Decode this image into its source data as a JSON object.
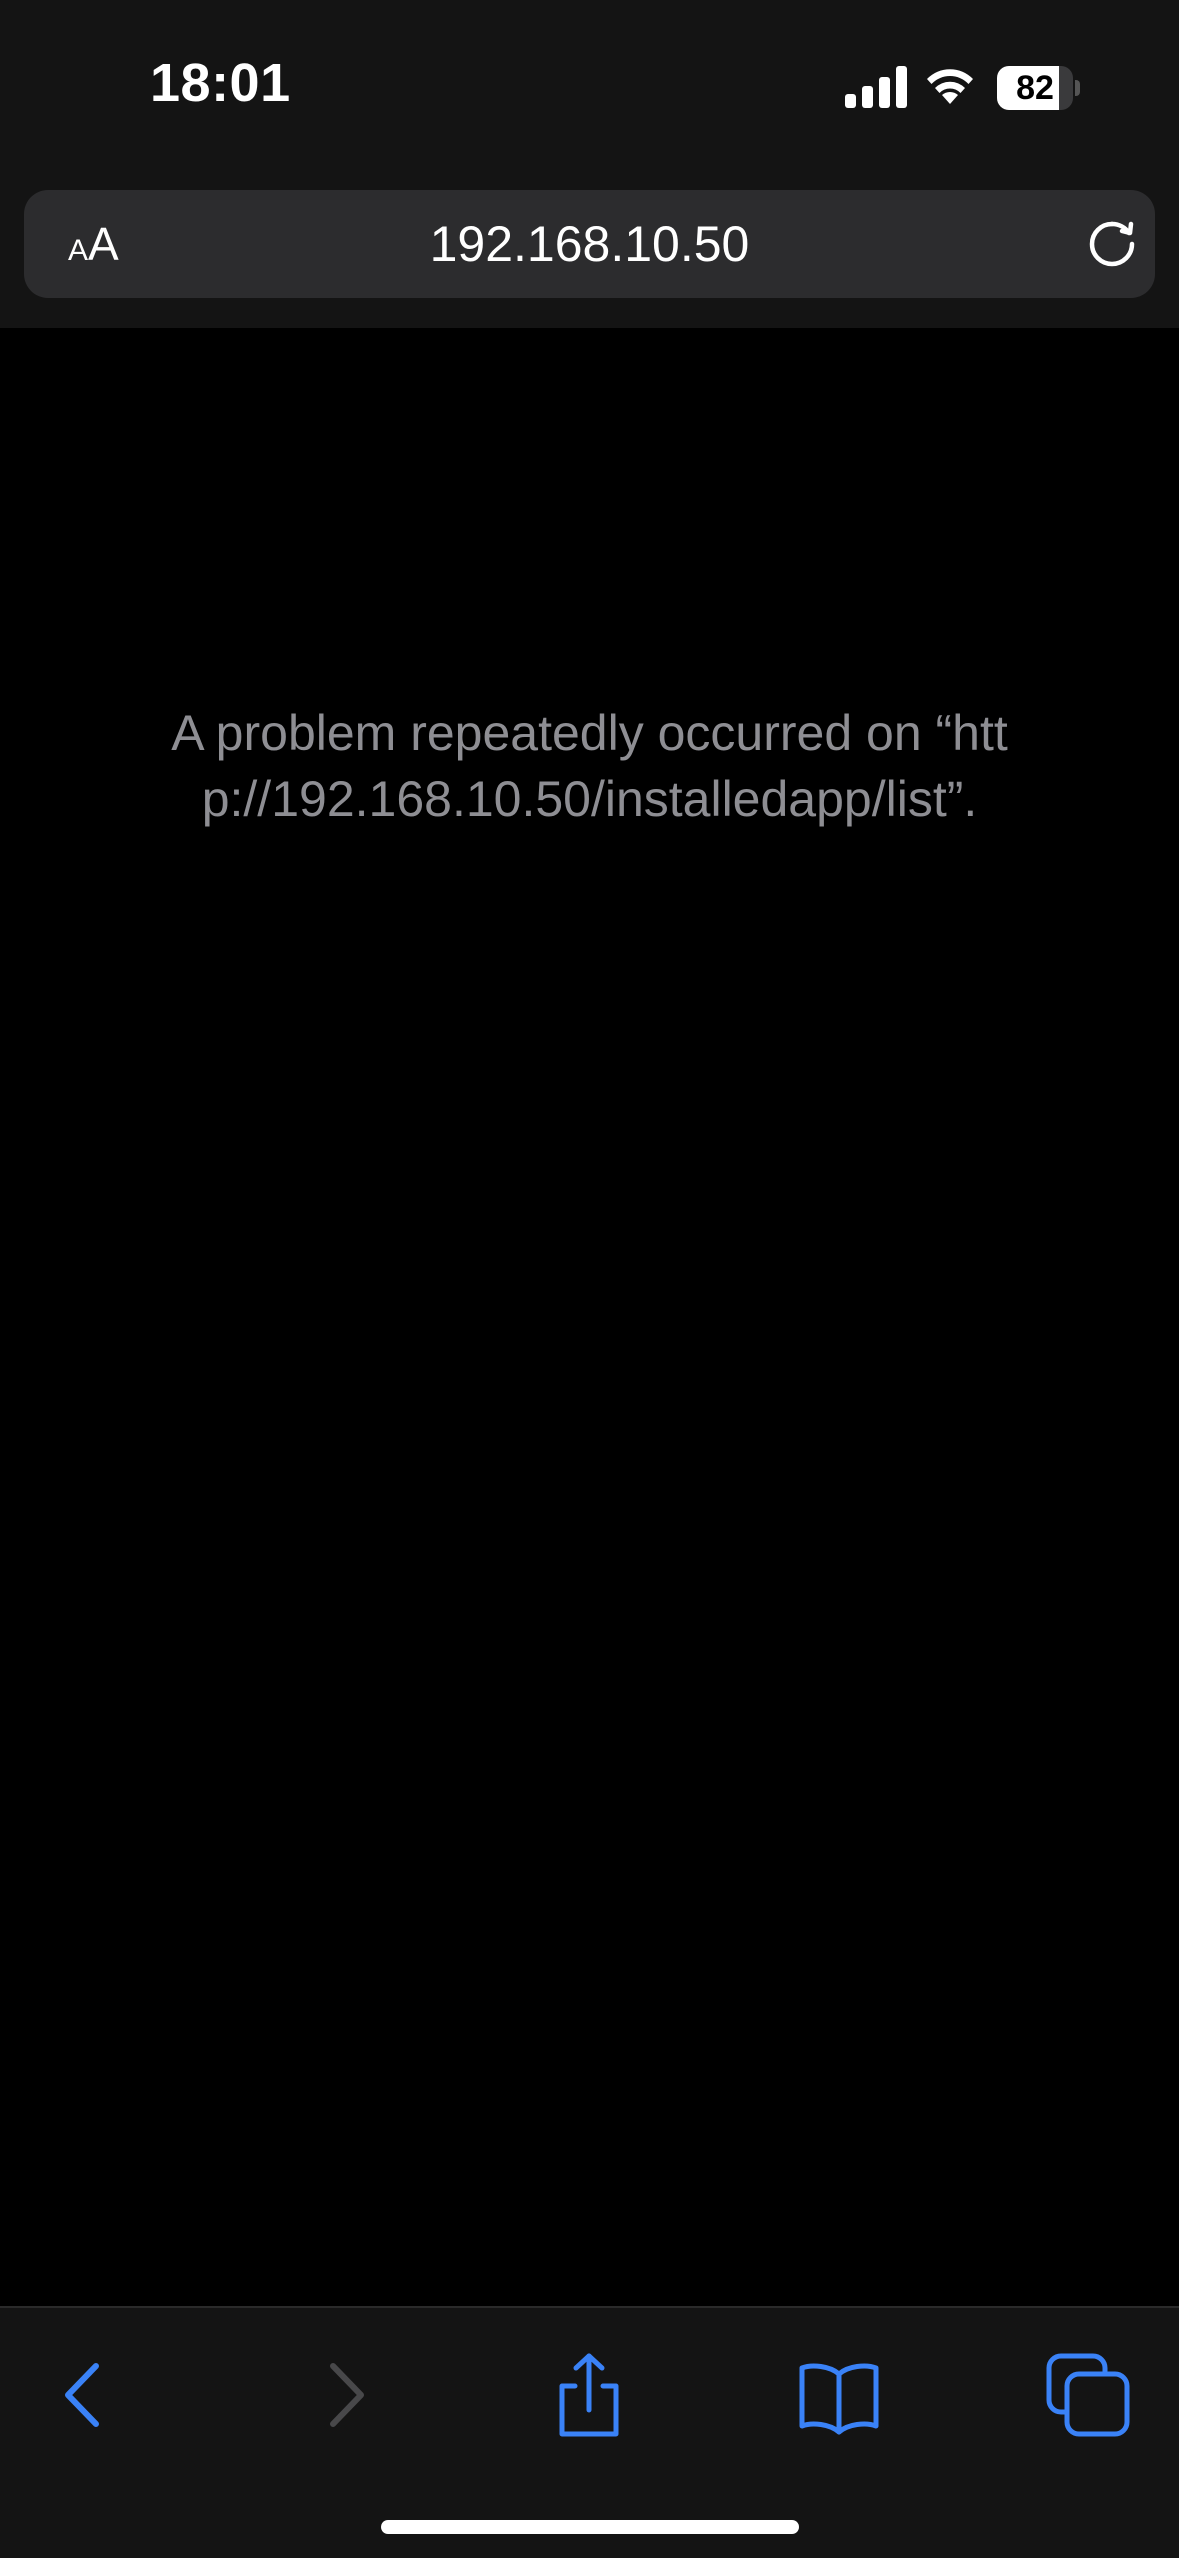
{
  "status_bar": {
    "time": "18:01",
    "battery_level": "82",
    "battery_fraction": 0.82
  },
  "address_bar": {
    "reader_small": "A",
    "reader_big": "A",
    "url": "192.168.10.50"
  },
  "error": {
    "message": "A problem repeatedly occurred on “http://192.168.10.50/installedapp/list”."
  },
  "icons": {
    "signal": "cellular-signal-icon",
    "wifi": "wifi-icon",
    "reload": "reload-icon",
    "back": "chevron-left-icon",
    "forward": "chevron-right-icon",
    "share": "share-icon",
    "bookmarks": "book-icon",
    "tabs": "tabs-icon"
  },
  "colors": {
    "accent": "#3a82f7",
    "disabled": "#48484a",
    "chrome_bg": "#141414",
    "message_text": "#8e8e93"
  }
}
